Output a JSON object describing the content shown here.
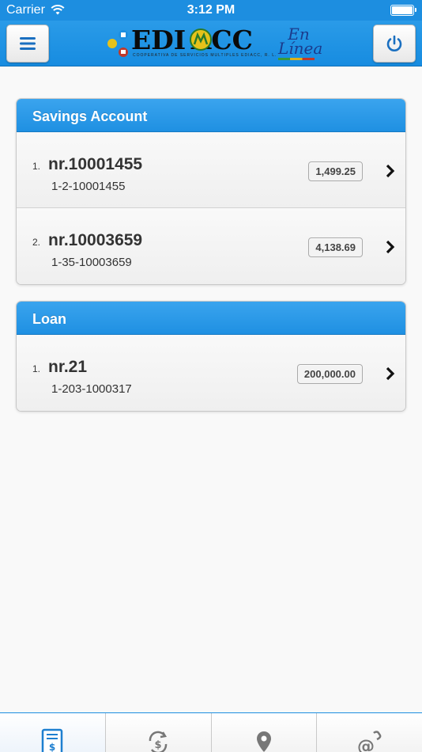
{
  "status_bar": {
    "carrier": "Carrier",
    "time": "3:12 PM",
    "icons": [
      "wifi-icon",
      "battery-icon"
    ]
  },
  "header": {
    "logo_text": "EDI ACC",
    "logo_sub": "En Línea",
    "logo_tagline": "COOPERATIVA DE SERVICIOS MULTIPLES EDIACC, R. L.",
    "icons": [
      "menu-icon",
      "power-icon"
    ]
  },
  "savings": {
    "title": "Savings Account",
    "items": [
      {
        "index": "1.",
        "title": "nr.10001455",
        "code": "1-2-10001455",
        "amount": "1,499.25"
      },
      {
        "index": "2.",
        "title": "nr.10003659",
        "code": "1-35-10003659",
        "amount": "4,138.69"
      }
    ]
  },
  "loan": {
    "title": "Loan",
    "items": [
      {
        "index": "1.",
        "title": "nr.21",
        "code": "1-203-1000317",
        "amount": "200,000.00"
      }
    ]
  },
  "tab_bar": {
    "active_index": 0,
    "tabs": [
      {
        "icon": "statement-icon"
      },
      {
        "icon": "transfer-icon"
      },
      {
        "icon": "location-icon"
      },
      {
        "icon": "contact-icon"
      }
    ]
  },
  "colors": {
    "brand_blue": "#1d8ee0",
    "header_gradient_top": "#3aa4ee",
    "background": "#f9f9f9"
  }
}
